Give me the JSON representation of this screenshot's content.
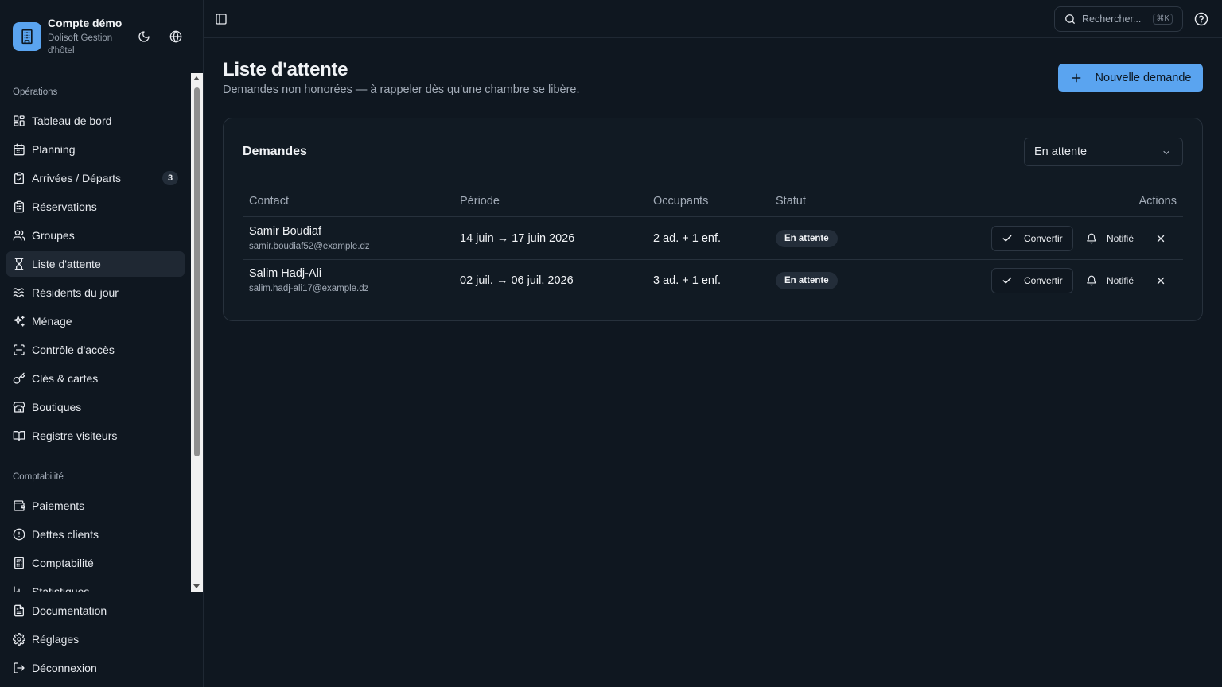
{
  "sidebar": {
    "brand_title": "Compte démo",
    "brand_subtitle": "Dolisoft Gestion d'hôtel",
    "sections": {
      "operations": "Opérations",
      "comptabilite": "Comptabilité"
    },
    "items": {
      "tableau": "Tableau de bord",
      "planning": "Planning",
      "arrivees": "Arrivées / Départs",
      "arrivees_badge": "3",
      "reservations": "Réservations",
      "groupes": "Groupes",
      "attente": "Liste d'attente",
      "residents": "Résidents du jour",
      "menage": "Ménage",
      "controle": "Contrôle d'accès",
      "cles": "Clés & cartes",
      "boutiques": "Boutiques",
      "registre": "Registre visiteurs",
      "paiements": "Paiements",
      "dettes": "Dettes clients",
      "comptabilite": "Comptabilité",
      "statistiques": "Statistiques"
    },
    "bottom": {
      "documentation": "Documentation",
      "reglages": "Réglages",
      "deconnexion": "Déconnexion"
    }
  },
  "topbar": {
    "search_placeholder": "Rechercher...",
    "search_shortcut": "⌘K"
  },
  "page": {
    "title": "Liste d'attente",
    "subtitle": "Demandes non honorées — à rappeler dès qu'une chambre se libère.",
    "new_button": "Nouvelle demande"
  },
  "card": {
    "title": "Demandes",
    "filter_value": "En attente",
    "columns": {
      "contact": "Contact",
      "periode": "Période",
      "occupants": "Occupants",
      "statut": "Statut",
      "actions": "Actions"
    },
    "rows": [
      {
        "name": "Samir Boudiaf",
        "email": "samir.boudiaf52@example.dz",
        "period": "14 juin → 17 juin 2026",
        "occupants": "2 ad. + 1 enf.",
        "status": "En attente",
        "convert": "Convertir",
        "notify": "Notifié"
      },
      {
        "name": "Salim Hadj-Ali",
        "email": "salim.hadj-ali17@example.dz",
        "period": "02 juil. → 06 juil. 2026",
        "occupants": "3 ad. + 1 enf.",
        "status": "En attente",
        "convert": "Convertir",
        "notify": "Notifié"
      }
    ]
  },
  "colors": {
    "background": "#0f1720",
    "accent": "#5aa4f0",
    "card_border": "#27313c",
    "active_nav": "#1f2833"
  }
}
